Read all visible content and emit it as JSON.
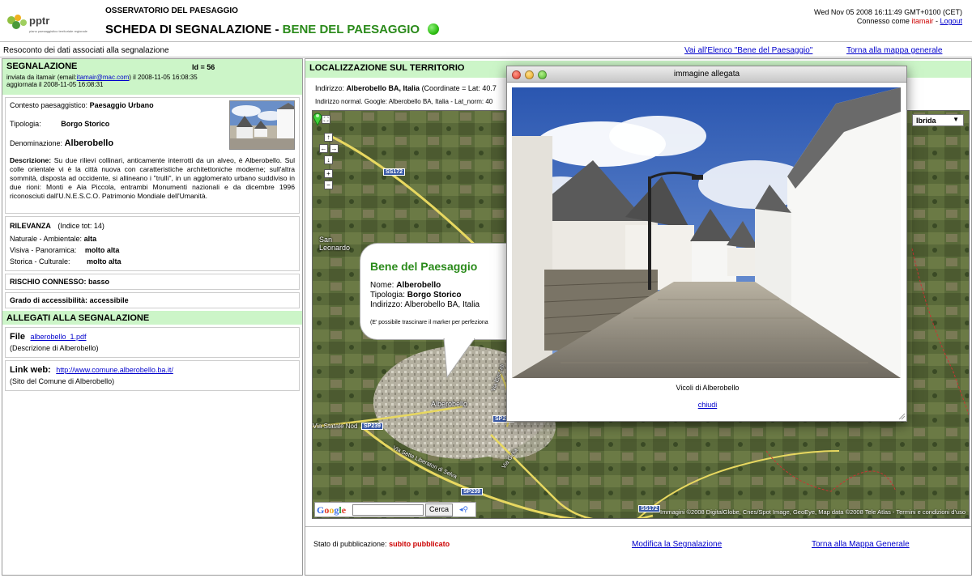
{
  "header": {
    "logo_text": "pptr",
    "logo_subtext": "piano paesaggistico territoriale regionale",
    "observatory": "OSSERVATORIO DEL PAESAGGIO",
    "title_prefix": "SCHEDA DI SEGNALAZIONE -",
    "title_highlight": "BENE DEL PAESAGGIO",
    "datetime": "Wed Nov 05 2008 16:11:49 GMT+0100 (CET)",
    "connected_as": "Connesso come",
    "user": "itamair",
    "separator": "-",
    "logout": "Logout"
  },
  "subbar": {
    "text": "Resoconto dei dati associati alla segnalazione",
    "link_elenco": "Vai all'Elenco \"Bene del Paesaggio\"",
    "link_mappa": "Torna alla mappa generale"
  },
  "left": {
    "segnalazione_title": "SEGNALAZIONE",
    "id_label": "Id = 56",
    "sent_prefix": "inviata da itamair (email:",
    "email": "itamair@mac.com",
    "sent_suffix": ") il 2008-11-05 16:08:35",
    "updated": "aggiornata il 2008-11-05 16:08:31",
    "contesto_label": "Contesto paesaggistico:",
    "contesto_value": "Paesaggio Urbano",
    "tipologia_label": "Tipologia:",
    "tipologia_value": "Borgo Storico",
    "denominazione_label": "Denominazione:",
    "denominazione_value": "Alberobello",
    "descr_label": "Descrizione:",
    "descr_text": "Su due rilievi collinari, anticamente interrotti da un alveo, è Alberobello. Sul colle orientale vi è la città nuova con caratteristiche architettoniche moderne; sull'altra sommità, disposta ad occidente, si allineano i \"trulli\", in un agglomerato urbano suddiviso in due rioni: Monti e Aia Piccola, entrambi Monumenti nazionali e da dicembre 1996 riconosciuti dall'U.N.E.S.C.O. Patrimonio Mondiale dell'Umanità.",
    "rilevanza_label": "RILEVANZA",
    "rilevanza_index": "(Indice tot: 14)",
    "rilevanze": [
      {
        "label": "Naturale - Ambientale:",
        "value": "alta"
      },
      {
        "label": "Visiva - Panoramica:",
        "value": "molto alta"
      },
      {
        "label": "Storica - Culturale:",
        "value": "molto alta"
      }
    ],
    "rischio": "RISCHIO CONNESSO: basso",
    "grado_label": "Grado di accessibilità:",
    "grado_value": "accessibile",
    "allegati_title": "ALLEGATI ALLA SEGNALAZIONE",
    "file_label": "File",
    "file_link": "alberobello_1.pdf",
    "file_desc": "(Descrizione di Alberobello)",
    "web_label": "Link web:",
    "web_link": "http://www.comune.alberobello.ba.it/",
    "web_desc": "(Sito del Comune di Alberobello)"
  },
  "right": {
    "loc_title": "LOCALIZZAZIONE SUL TERRITORIO",
    "addr_label": "Indirizzo:",
    "addr_value": "Alberobello BA, Italia",
    "addr_coords": "(Coordinate = Lat: 40.7",
    "addr_norm": "Indirizzo normal. Google: Alberobello BA, Italia - Lat_norm: 40",
    "map_type": "Ibrida",
    "place_san_leonardo": "San\nLeonardo",
    "place_alberobello": "Alberobello",
    "roads": [
      "SS172",
      "SP239",
      "SP239",
      "SS172",
      "SP239"
    ],
    "road_text1": "Via Sette Liberatori di Selva",
    "road_text2": "Via Gioia",
    "road_text3": "Via Statale Nod",
    "road_text4": "Via Einaudi",
    "google_label": "Google",
    "search_button": "Cerca",
    "copyright": "Immagini ©2008 DigitalGlobe, Cnes/Spot Image, GeoEye, Map data ©2008 Tele Atlas - Termini e condizioni d'uso",
    "bubble_title": "Bene del Paesaggio",
    "bubble_nome_label": "Nome:",
    "bubble_nome": "Alberobello",
    "bubble_tip_label": "Tipologia:",
    "bubble_tip": "Borgo Storico",
    "bubble_ind_label": "Indirizzo:",
    "bubble_ind": "Alberobello BA, Italia",
    "bubble_note": "(E' possibile trascinare il marker per perfeziona",
    "stato_label": "Stato di pubblicazione:",
    "stato_value": "subito pubblicato",
    "modifica": "Modifica la Segnalazione",
    "torna": "Torna alla Mappa Generale"
  },
  "popup": {
    "title": "immagine allegata",
    "caption": "Vicoli di Alberobello",
    "close": "chiudi"
  },
  "colors": {
    "header_green": "#ccf5c8",
    "title_green": "#2a8a1a",
    "user_red": "#cc0000",
    "link_blue": "#0000cc"
  }
}
